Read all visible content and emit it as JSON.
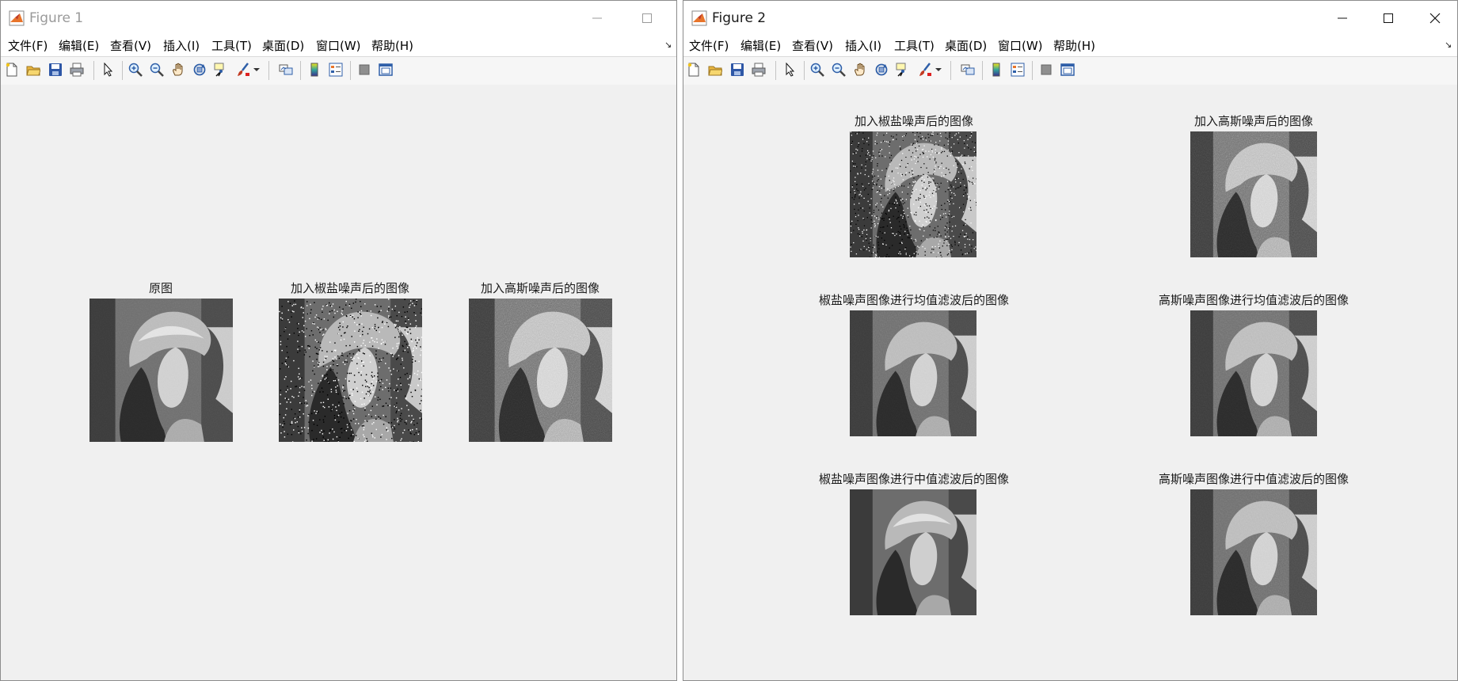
{
  "menu": [
    "文件(F)",
    "编辑(E)",
    "查看(V)",
    "插入(I)",
    "工具(T)",
    "桌面(D)",
    "窗口(W)",
    "帮助(H)"
  ],
  "figure1": {
    "title": "Figure 1",
    "subplots": [
      {
        "title": "原图",
        "noise": "none"
      },
      {
        "title": "加入椒盐噪声后的图像",
        "noise": "salt-pepper"
      },
      {
        "title": "加入高斯噪声后的图像",
        "noise": "gaussian"
      }
    ]
  },
  "figure2": {
    "title": "Figure 2",
    "subplots": [
      {
        "title": "加入椒盐噪声后的图像",
        "noise": "salt-pepper"
      },
      {
        "title": "加入高斯噪声后的图像",
        "noise": "gaussian"
      },
      {
        "title": "椒盐噪声图像进行均值滤波后的图像",
        "noise": "mean-filtered"
      },
      {
        "title": "高斯噪声图像进行均值滤波后的图像",
        "noise": "mean-filtered-gaussian"
      },
      {
        "title": "椒盐噪声图像进行中值滤波后的图像",
        "noise": "median-filtered"
      },
      {
        "title": "高斯噪声图像进行中值滤波后的图像",
        "noise": "median-filtered-gaussian"
      }
    ]
  },
  "toolbar_icons": [
    "new-figure-icon",
    "open-file-icon",
    "save-icon",
    "print-icon",
    "select-arrow-icon",
    "zoom-in-icon",
    "zoom-out-icon",
    "pan-hand-icon",
    "rotate-3d-icon",
    "data-cursor-icon",
    "brush-icon",
    "brush-dropdown-icon",
    "link-plot-icon",
    "colorbar-icon",
    "legend-icon",
    "hide-plot-tools-icon",
    "show-plot-tools-icon"
  ],
  "colors": {
    "matlab_orange": "#e8742a",
    "matlab_red": "#c23b22",
    "window_bg": "#f0f0f0"
  }
}
